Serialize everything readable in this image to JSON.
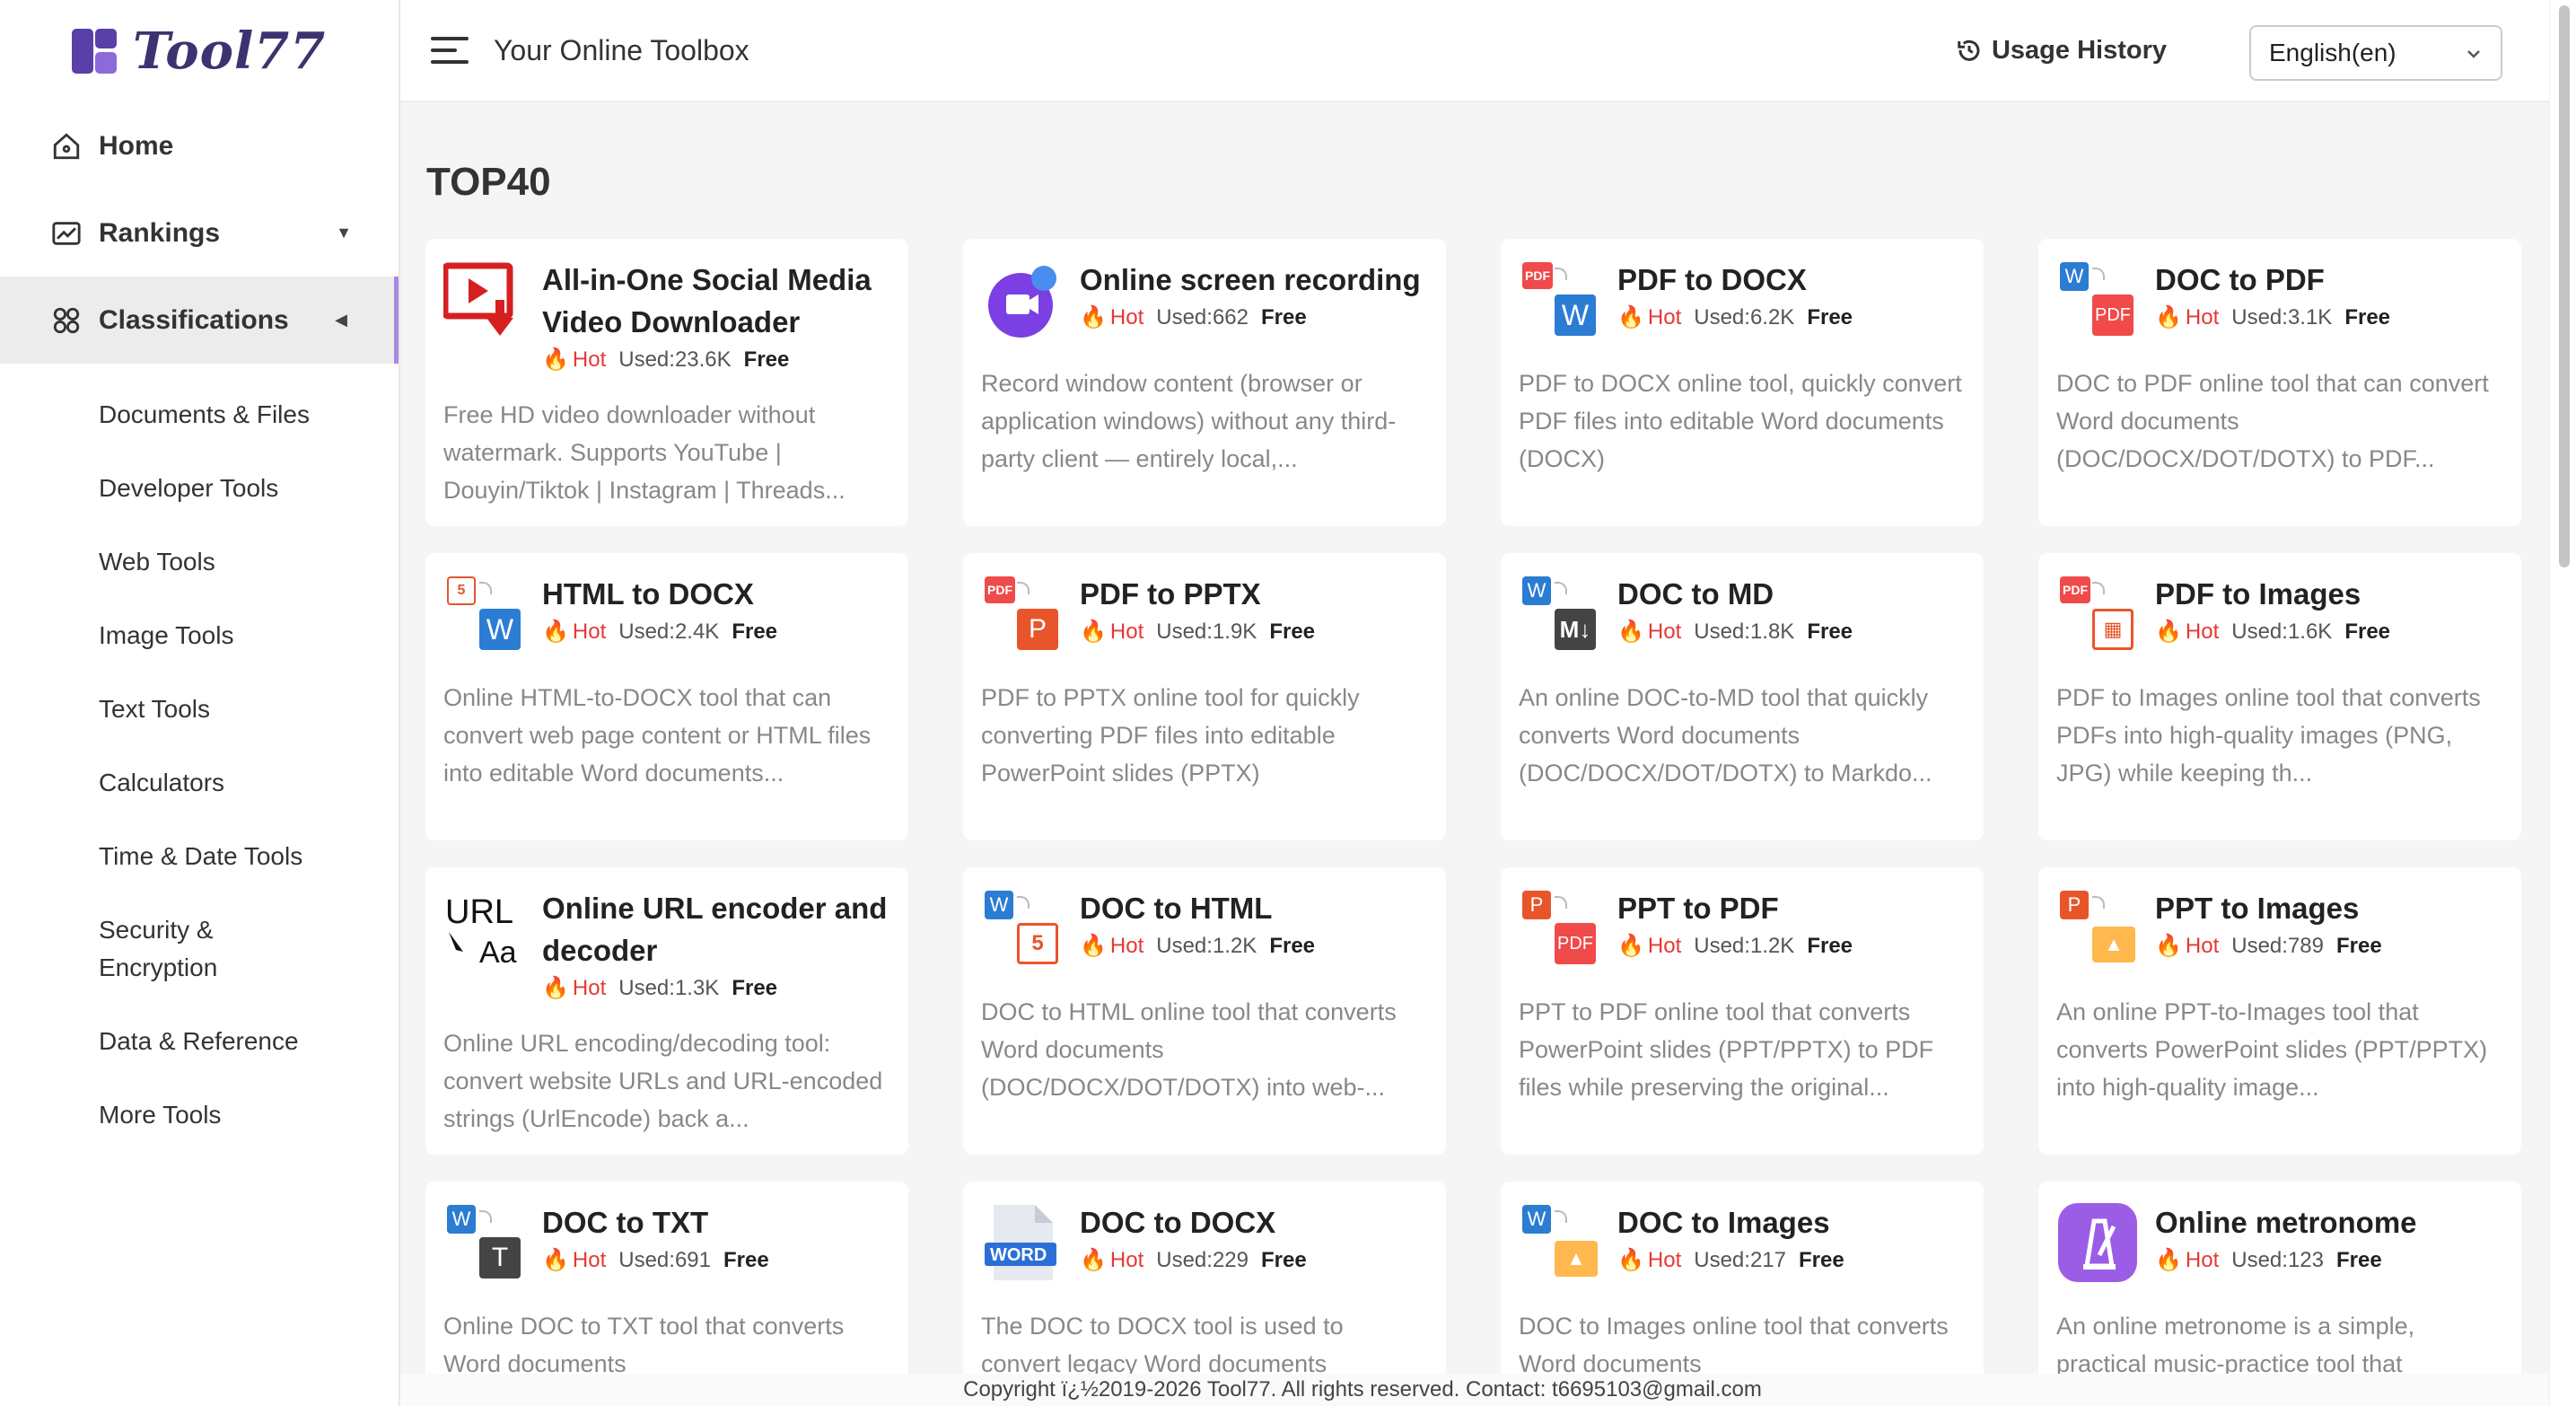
{
  "brand": {
    "name": "Tool77"
  },
  "sidebar": {
    "home": "Home",
    "rankings": "Rankings",
    "classifications": "Classifications",
    "subs": [
      "Documents & Files",
      "Developer Tools",
      "Web Tools",
      "Image Tools",
      "Text Tools",
      "Calculators",
      "Time & Date Tools",
      "Security & Encryption",
      "Data & Reference",
      "More Tools"
    ]
  },
  "header": {
    "title": "Your Online Toolbox",
    "usage_history": "Usage History",
    "language": "English(en)"
  },
  "main": {
    "section_title": "TOP40",
    "hot_label": "Hot",
    "free_label": "Free",
    "cards": [
      {
        "title": "All-in-One Social Media Video Downloader",
        "used": "Used:23.6K",
        "desc": "Free HD video downloader without watermark. Supports YouTube | Douyin/Tiktok | Instagram | Threads...",
        "icon": "video-download-icon"
      },
      {
        "title": "Online screen recording",
        "used": "Used:662",
        "desc": "Record window content (browser or application windows) without any third-party client — entirely local,...",
        "icon": "screen-record-icon"
      },
      {
        "title": "PDF to DOCX",
        "used": "Used:6.2K",
        "desc": "PDF to DOCX online tool, quickly convert PDF files into editable Word documents (DOCX)",
        "icon": "pdf-to-docx-icon"
      },
      {
        "title": "DOC to PDF",
        "used": "Used:3.1K",
        "desc": "DOC to PDF online tool that can convert Word documents (DOC/DOCX/DOT/DOTX) to PDF...",
        "icon": "doc-to-pdf-icon"
      },
      {
        "title": "HTML to DOCX",
        "used": "Used:2.4K",
        "desc": "Online HTML-to-DOCX tool that can convert web page content or HTML files into editable Word documents...",
        "icon": "html-to-docx-icon"
      },
      {
        "title": "PDF to PPTX",
        "used": "Used:1.9K",
        "desc": "PDF to PPTX online tool for quickly converting PDF files into editable PowerPoint slides (PPTX)",
        "icon": "pdf-to-pptx-icon"
      },
      {
        "title": "DOC to MD",
        "used": "Used:1.8K",
        "desc": "An online DOC-to-MD tool that quickly converts Word documents (DOC/DOCX/DOT/DOTX) to Markdo...",
        "icon": "doc-to-md-icon"
      },
      {
        "title": "PDF to Images",
        "used": "Used:1.6K",
        "desc": "PDF to Images online tool that converts PDFs into high-quality images (PNG, JPG) while keeping th...",
        "icon": "pdf-to-images-icon"
      },
      {
        "title": "Online URL encoder and decoder",
        "used": "Used:1.3K",
        "desc": "Online URL encoding/decoding tool: convert website URLs and URL-encoded strings (UrlEncode) back a...",
        "icon": "url-encoder-icon"
      },
      {
        "title": "DOC to HTML",
        "used": "Used:1.2K",
        "desc": "DOC to HTML online tool that converts Word documents (DOC/DOCX/DOT/DOTX) into web-...",
        "icon": "doc-to-html-icon"
      },
      {
        "title": "PPT to PDF",
        "used": "Used:1.2K",
        "desc": "PPT to PDF online tool that converts PowerPoint slides (PPT/PPTX) to PDF files while preserving the original...",
        "icon": "ppt-to-pdf-icon"
      },
      {
        "title": "PPT to Images",
        "used": "Used:789",
        "desc": "An online PPT-to-Images tool that converts PowerPoint slides (PPT/PPTX) into high-quality image...",
        "icon": "ppt-to-images-icon"
      },
      {
        "title": "DOC to TXT",
        "used": "Used:691",
        "desc": "Online DOC to TXT tool that converts Word documents",
        "icon": "doc-to-txt-icon"
      },
      {
        "title": "DOC to DOCX",
        "used": "Used:229",
        "desc": "The DOC to DOCX tool is used to convert legacy Word documents",
        "icon": "doc-to-docx-icon"
      },
      {
        "title": "DOC to Images",
        "used": "Used:217",
        "desc": "DOC to Images online tool that converts Word documents",
        "icon": "doc-to-images-icon"
      },
      {
        "title": "Online metronome",
        "used": "Used:123",
        "desc": "An online metronome is a simple, practical music-practice tool that",
        "icon": "metronome-icon"
      }
    ]
  },
  "footer": {
    "text": "Copyright ï¿½2019-2026 Tool77. All rights reserved. Contact: t6695103@gmail.com"
  },
  "colors": {
    "accent": "#a58be0",
    "hot": "#e53935",
    "word": "#2b7cd3",
    "pdf": "#f04a4a",
    "ppt": "#e8552b"
  }
}
